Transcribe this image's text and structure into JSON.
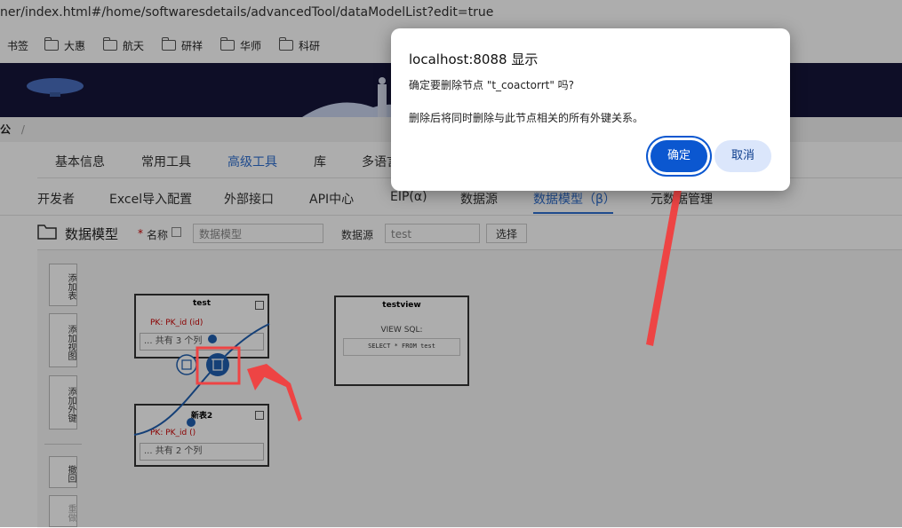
{
  "browser": {
    "url": "ner/index.html#/home/softwaresdetails/advancedTool/dataModelList?edit=true",
    "bookmarks": [
      {
        "label": "书签",
        "has_folder_icon": false
      },
      {
        "label": "大惠",
        "has_folder_icon": true
      },
      {
        "label": "航天",
        "has_folder_icon": true
      },
      {
        "label": "研祥",
        "has_folder_icon": true
      },
      {
        "label": "华师",
        "has_folder_icon": true
      },
      {
        "label": "科研",
        "has_folder_icon": true
      }
    ]
  },
  "breadcrumb": {
    "text": "公",
    "separator": "/"
  },
  "tabs_primary": [
    "基本信息",
    "常用工具",
    "高级工具",
    "库",
    "多语言"
  ],
  "tabs_primary_active": "高级工具",
  "tabs_secondary": [
    "开发者",
    "Excel导入配置",
    "外部接口",
    "API中心",
    "EIP(α)",
    "数据源",
    "数据模型（β）",
    "元数据管理"
  ],
  "tabs_secondary_active": "数据模型（β）",
  "toolbar": {
    "title": "数据模型",
    "name_required_mark": "*",
    "name_label": "名称",
    "name_value": "数据模型",
    "datasource_label": "数据源",
    "datasource_value": "test",
    "select_button": "选择"
  },
  "side_buttons": [
    "添加表",
    "添加视图",
    "添加外键",
    "撤回",
    "重做"
  ],
  "canvas": {
    "nodes": [
      {
        "title": "test",
        "pk": "PK: PK_id (id)",
        "columns": "... 共有 3 个列"
      },
      {
        "title": "新表2",
        "pk": "PK: PK_id ()",
        "columns": "... 共有 2 个列"
      },
      {
        "title": "testview",
        "view_label": "VIEW SQL:",
        "sql": "SELECT * FROM test"
      }
    ]
  },
  "dialog": {
    "title": "localhost:8088 显示",
    "message": "确定要删除节点 \"t_coactorrt\" 吗?",
    "detail": "删除后将同时删除与此节点相关的所有外键关系。",
    "confirm_label": "确定",
    "cancel_label": "取消"
  },
  "colors": {
    "annotation_red": "#ee4444",
    "confirm_blue": "#0b57d0",
    "cancel_bg": "#dbe6fb",
    "active_tab": "#2f6fd0",
    "edge_blue": "#1f5fb0"
  }
}
